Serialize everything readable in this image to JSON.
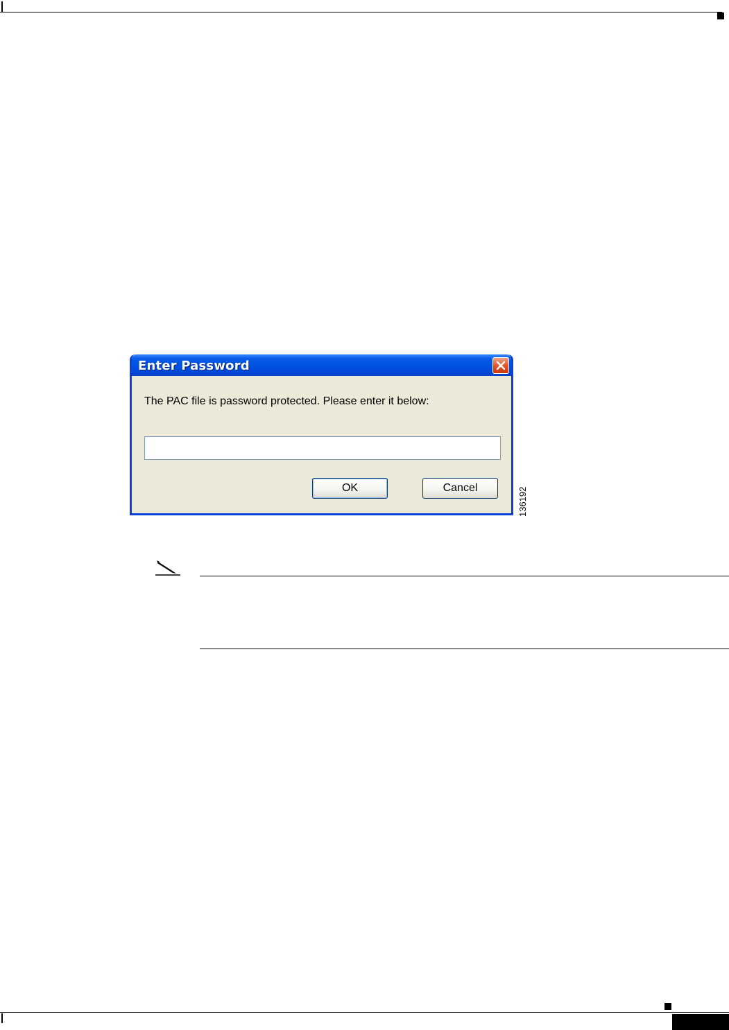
{
  "dialog": {
    "title": "Enter Password",
    "message": "The PAC file is password protected. Please enter it below:",
    "password_value": "",
    "ok_label": "OK",
    "cancel_label": "Cancel",
    "close_icon": "close-icon"
  },
  "figure": {
    "id": "136192"
  },
  "note": {
    "icon": "pencil-icon"
  },
  "colors": {
    "titlebar": "#0054e3",
    "dialog_body": "#ece9d8",
    "close_button": "#e4552a"
  }
}
